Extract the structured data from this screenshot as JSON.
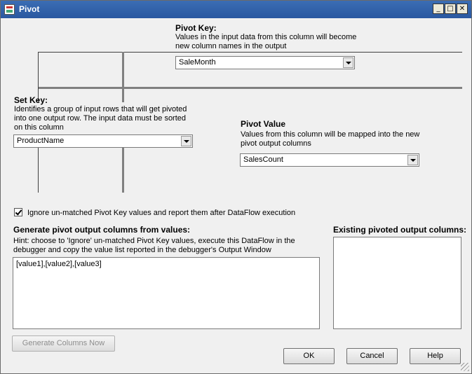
{
  "window": {
    "title": "Pivot"
  },
  "pivot_key": {
    "header": "Pivot Key:",
    "description_line1": "Values in the input data from this column will become",
    "description_line2": "new column names in the output",
    "selected": "SaleMonth"
  },
  "set_key": {
    "header": "Set Key:",
    "description_line1": "Identifies a group of input rows that will get pivoted",
    "description_line2": "into one output row. The input data must be sorted",
    "description_line3": "on this column",
    "selected": "ProductName"
  },
  "pivot_value": {
    "header": "Pivot Value",
    "description_line1": "Values from this column will be mapped into the new",
    "description_line2": "pivot output columns",
    "selected": "SalesCount"
  },
  "ignore_checkbox": {
    "checked": true,
    "label": "Ignore un-matched Pivot Key values and report them after DataFlow execution"
  },
  "generate": {
    "header": "Generate pivot output columns from values:",
    "hint_line1": "Hint: choose to 'Ignore' un-matched Pivot Key values, execute this DataFlow in the",
    "hint_line2": "debugger and copy the value list reported in the debugger's Output Window",
    "value": "[value1],[value2],[value3]",
    "button_label": "Generate Columns Now"
  },
  "existing": {
    "header": "Existing pivoted output columns:"
  },
  "buttons": {
    "ok": "OK",
    "cancel": "Cancel",
    "help": "Help"
  }
}
